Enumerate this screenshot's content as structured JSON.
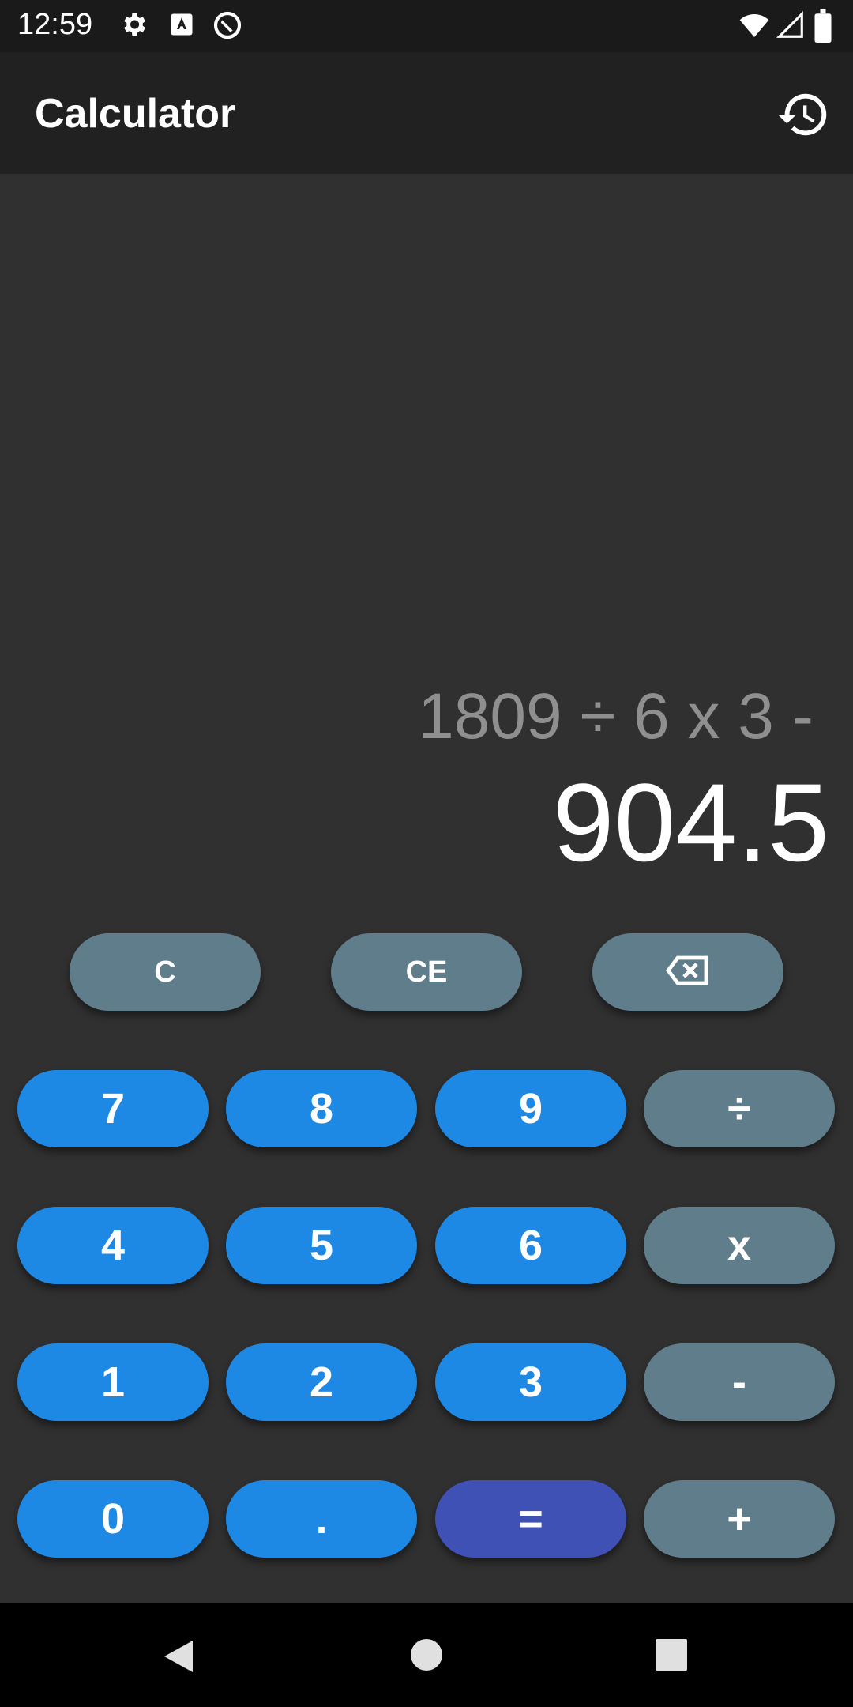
{
  "status_bar": {
    "time": "12:59",
    "icons_left": [
      "gear-icon",
      "text-a-icon",
      "circle-arrow-icon"
    ],
    "icons_right": [
      "wifi-icon",
      "signal-icon",
      "battery-icon"
    ]
  },
  "app_bar": {
    "title": "Calculator",
    "history_icon": "history-icon"
  },
  "display": {
    "expression": "1809 ÷ 6 x 3 -",
    "result": "904.5"
  },
  "keypad": {
    "top_row": [
      {
        "label": "C",
        "name": "clear-button"
      },
      {
        "label": "CE",
        "name": "clear-entry-button"
      },
      {
        "label": "⌫",
        "name": "backspace-button",
        "icon": "backspace-icon"
      }
    ],
    "rows": [
      [
        "7",
        "8",
        "9",
        "÷"
      ],
      [
        "4",
        "5",
        "6",
        "x"
      ],
      [
        "1",
        "2",
        "3",
        "-"
      ],
      [
        "0",
        ".",
        "=",
        "+"
      ]
    ]
  },
  "colors": {
    "number_key": "#1e88e5",
    "operator_key": "#607d8b",
    "equals_key": "#3f51b5",
    "background": "#303030",
    "app_bar": "#212121"
  },
  "nav_bar": {
    "icons": [
      "back-icon",
      "home-icon",
      "recents-icon"
    ]
  }
}
